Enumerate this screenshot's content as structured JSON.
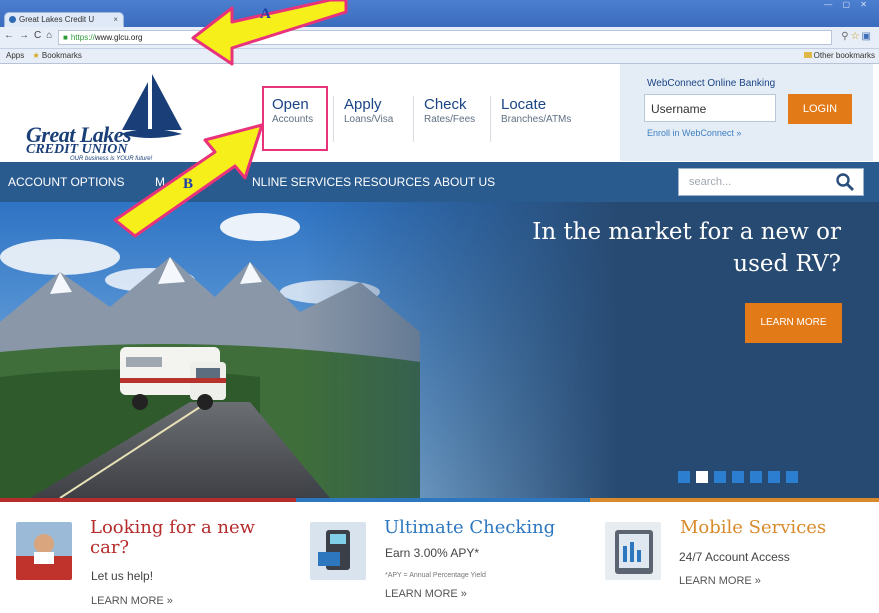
{
  "browser": {
    "tab_title": "Great Lakes Credit U",
    "tab_close": "×",
    "url_https": "https://",
    "url_domain": "www.glcu.org",
    "bookmarks": {
      "apps": "Apps",
      "bookmarks": "Bookmarks",
      "other": "Other bookmarks"
    }
  },
  "header": {
    "logo": {
      "line1": "Great Lakes",
      "line2": "CREDIT UNION",
      "tagline": "OUR business is YOUR future!"
    },
    "links": [
      {
        "title": "Open",
        "sub": "Accounts"
      },
      {
        "title": "Apply",
        "sub": "Loans/Visa"
      },
      {
        "title": "Check",
        "sub": "Rates/Fees"
      },
      {
        "title": "Locate",
        "sub": "Branches/ATMs"
      }
    ],
    "webconnect": {
      "title": "WebConnect Online Banking",
      "username_value": "Username",
      "login_label": "LOGIN",
      "enroll_label": "Enroll in WebConnect »"
    }
  },
  "nav": {
    "items": [
      "ACCOUNT OPTIONS",
      "M",
      "NLINE SERVICES",
      "RESOURCES",
      "ABOUT US"
    ],
    "search_placeholder": "search..."
  },
  "hero": {
    "headline_line1": "In the market for a new or",
    "headline_line2": "used RV?",
    "cta_label": "LEARN MORE",
    "slides_total": 7,
    "slide_active": 2
  },
  "promos": [
    {
      "title_line1": "Looking for a new",
      "title_line2": "car?",
      "sub": "Let us help!",
      "fine": "",
      "more": "LEARN MORE »",
      "accent": "#b52c2c"
    },
    {
      "title_line1": "Ultimate Checking",
      "title_line2": "",
      "sub": "Earn 3.00% APY*",
      "fine": "*APY = Annual Percentage Yield",
      "more": "LEARN MORE »",
      "accent": "#2d77bf"
    },
    {
      "title_line1": "Mobile Services",
      "title_line2": "",
      "sub": "24/7 Account Access",
      "fine": "",
      "more": "LEARN MORE »",
      "accent": "#d98a2c"
    }
  ],
  "annotations": {
    "a_label": "A",
    "b_label": "B"
  },
  "colors": {
    "brand_blue": "#1b4485",
    "nav_blue": "#2a5b8f",
    "accent_orange": "#e27a17",
    "annotation_yellow": "#f7ef1a",
    "annotation_pink": "#e8337a"
  }
}
